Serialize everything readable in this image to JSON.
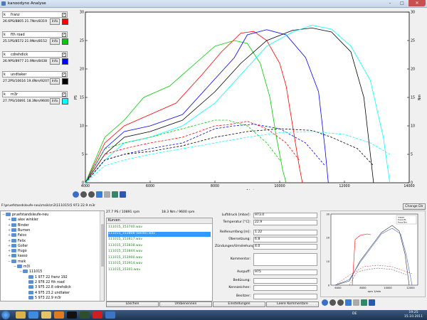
{
  "window": {
    "title": "kanoodyno Analyse"
  },
  "window_controls": {
    "minimize": "–",
    "maximize": "□",
    "close": "✕"
  },
  "cars": [
    {
      "name": "franz",
      "stats": "26.6PS/8805   21.7Nm/8319",
      "info": "Info",
      "color": "#ff0000",
      "checked": "✓"
    },
    {
      "name": "fth road",
      "stats": "25.1PS/8572   21.9Nm/8152",
      "info": "Info",
      "color": "#00cc00",
      "checked": "✓"
    },
    {
      "name": "cdrehdick",
      "stats": "26.9PS/8977   21.9Nm/8438",
      "info": "Info",
      "color": "#0000ff",
      "checked": "✓"
    },
    {
      "name": "undtaker",
      "stats": "27.2PS/10616  19.4Nm/9207",
      "info": "Info",
      "color": "#000000",
      "checked": "✓"
    },
    {
      "name": "m3r",
      "stats": "27.7PS/10891  18.3Nm/9600",
      "info": "Info",
      "color": "#00ffff",
      "checked": "✓"
    }
  ],
  "chart_data": {
    "type": "line",
    "title": "",
    "xlabel": "rpm 1/min",
    "ylabel_left": "PS",
    "ylabel_right": "Nm",
    "xlim": [
      4000,
      14000
    ],
    "ylim_left": [
      0,
      30
    ],
    "ylim_right": [
      0,
      30
    ],
    "x_ticks": [
      4000,
      6000,
      8000,
      10000,
      12000,
      14000
    ],
    "y_ticks_left": [
      0,
      5,
      10,
      15,
      20,
      25,
      30
    ],
    "y_ticks_right": [
      0,
      5,
      10,
      15,
      20,
      25,
      30
    ],
    "grid": false,
    "series": [
      {
        "color": "#ff0000",
        "kind": "power",
        "x": [
          4000,
          4600,
          5200,
          6000,
          6800,
          7600,
          8200,
          8800,
          9200,
          9600,
          10000,
          10200,
          10400,
          10600,
          10700
        ],
        "y": [
          0,
          7,
          10,
          12,
          14,
          19,
          23,
          26.3,
          26.6,
          25,
          21,
          17,
          10,
          3,
          0
        ]
      },
      {
        "color": "#00cc00",
        "kind": "power",
        "x": [
          4000,
          4600,
          5200,
          5800,
          6600,
          7400,
          8000,
          8600,
          9000,
          9400,
          9700,
          9900,
          10100,
          10200
        ],
        "y": [
          0,
          8,
          11,
          15,
          17,
          21,
          24,
          25,
          24.5,
          21,
          15,
          8,
          2,
          0
        ]
      },
      {
        "color": "#0000ff",
        "kind": "power",
        "x": [
          4000,
          4600,
          5200,
          6000,
          7000,
          7800,
          8600,
          9000,
          9600,
          10200,
          10800,
          11200,
          11400,
          11500
        ],
        "y": [
          0,
          6,
          9,
          10,
          12,
          17,
          22,
          26,
          26.9,
          26,
          22,
          16,
          6,
          0
        ]
      },
      {
        "color": "#000000",
        "kind": "power",
        "x": [
          4000,
          4600,
          5200,
          6000,
          7000,
          8000,
          8800,
          9600,
          10400,
          11000,
          11600,
          12200,
          12600,
          12800,
          12900
        ],
        "y": [
          0,
          5,
          8,
          9,
          11,
          16,
          21,
          25,
          26.8,
          27.2,
          26.5,
          23,
          15,
          5,
          0
        ]
      },
      {
        "color": "#00ffff",
        "kind": "power",
        "x": [
          4000,
          4600,
          5200,
          6000,
          7000,
          8000,
          8800,
          9600,
          10400,
          11000,
          11600,
          12200,
          12800,
          13200,
          13400
        ],
        "y": [
          0,
          4,
          7,
          8,
          10,
          14,
          19,
          24,
          26.5,
          27.7,
          27,
          24,
          18,
          8,
          0
        ]
      },
      {
        "color": "#ff0000",
        "kind": "torque",
        "x": [
          4000,
          4600,
          5200,
          6000,
          7000,
          8000,
          8400,
          9000,
          9600,
          10200,
          10600
        ],
        "y": [
          0,
          5,
          6,
          7,
          8,
          10,
          10.2,
          10.8,
          9.5,
          7,
          4
        ]
      },
      {
        "color": "#00cc00",
        "kind": "torque",
        "x": [
          4000,
          4600,
          5200,
          6000,
          7000,
          8000,
          8400,
          9000,
          9600,
          10000
        ],
        "y": [
          0,
          6,
          7,
          8,
          9.5,
          11,
          11,
          10,
          7,
          4
        ]
      },
      {
        "color": "#0000ff",
        "kind": "torque",
        "x": [
          4000,
          4600,
          5200,
          6000,
          7000,
          8000,
          8600,
          9200,
          10000,
          10800,
          11400
        ],
        "y": [
          0,
          4,
          5,
          6,
          7,
          9.5,
          10,
          10.3,
          9.5,
          7,
          3
        ]
      },
      {
        "color": "#000000",
        "kind": "torque",
        "x": [
          4000,
          4600,
          5200,
          6000,
          7000,
          8000,
          9000,
          10000,
          11000,
          11600,
          12400,
          12900
        ],
        "y": [
          0,
          4,
          5,
          5.5,
          6.5,
          8,
          9,
          9.5,
          9.2,
          8,
          6,
          3
        ]
      },
      {
        "color": "#00ffff",
        "kind": "torque",
        "x": [
          4000,
          4600,
          5200,
          6000,
          7000,
          8000,
          9000,
          10000,
          11000,
          12000,
          12800,
          13400
        ],
        "y": [
          0,
          3,
          4,
          5,
          6,
          7,
          8,
          8.8,
          9,
          8.5,
          7,
          5
        ]
      }
    ]
  },
  "path": {
    "text": "F:\\pruefstandsleufe-neu\\msik\\m3\\111015\\5 973 22.9 m3r",
    "change_button": "Change Dir"
  },
  "tree": [
    {
      "label": "pruefstandsleufe-neu",
      "level": 0,
      "exp": "−"
    },
    {
      "label": "alex winkler",
      "level": 1,
      "exp": "+"
    },
    {
      "label": "Binder",
      "level": 1,
      "exp": "+"
    },
    {
      "label": "Burnen",
      "level": 1,
      "exp": "+"
    },
    {
      "label": "Falco",
      "level": 1,
      "exp": "+"
    },
    {
      "label": "Felix",
      "level": 1,
      "exp": "+"
    },
    {
      "label": "Goller",
      "level": 1,
      "exp": "+"
    },
    {
      "label": "Hugo",
      "level": 1,
      "exp": "+"
    },
    {
      "label": "kasso",
      "level": 1,
      "exp": "+"
    },
    {
      "label": "msik",
      "level": 1,
      "exp": "−"
    },
    {
      "label": "m3l",
      "level": 2,
      "exp": "−"
    },
    {
      "label": "111015",
      "level": 3,
      "exp": "−"
    },
    {
      "label": "1 977 22 franz 192",
      "level": 4,
      "exp": ""
    },
    {
      "label": "2 976 22 fth road",
      "level": 4,
      "exp": ""
    },
    {
      "label": "3 975 22.8 cdrehdick",
      "level": 4,
      "exp": ""
    },
    {
      "label": "4 975 23.2 undtaker",
      "level": 4,
      "exp": ""
    },
    {
      "label": "5 973 22.9 m3r",
      "level": 4,
      "exp": ""
    }
  ],
  "curves": {
    "summary_power": "27.7 PS / 10891 rpm",
    "summary_torque": "18.3 Nm / 9600 rpm",
    "header": "Kurven",
    "items": [
      "111015_153740.wav",
      "111015_153808 (beste).wav",
      "111015_153817.wav",
      "111015_153838.wav",
      "111015_153844.wav",
      "111015_153900.wav",
      "111015_153914.wav",
      "111015_15301.wav"
    ],
    "selected_index": 1
  },
  "form": {
    "luftdruck_label": "Luftdruck [mbar]:",
    "luftdruck": "973.0",
    "temperatur_label": "Temperatur [°C]:",
    "temperatur": "22.9",
    "reifenumfang_label": "Reifenumfang [m]:",
    "reifenumfang": "1.22",
    "uebersetzung_label": "Übersetzung:",
    "uebersetzung": "6.8",
    "zuendungen_label": "Zündungen/Umdrehung:",
    "zuendungen": "4.0",
    "kommentar_label": "Kommentar:",
    "kommentar": "",
    "auspuff_label": "Auspuff:",
    "auspuff": "975",
    "bedusung_label": "Bedüsung:",
    "bedusung": "",
    "kennzeichen_label": "Kennzeichen:",
    "kennzeichen": "",
    "besitzer_label": "Besitzer:",
    "besitzer": ""
  },
  "buttons": {
    "loeschen": "Löschen",
    "umbenennen": "Umbenennen",
    "einstellungen": "Einstellungen",
    "leere_kommentare": "Leere Kommentare"
  },
  "mini_chart": {
    "legend": [
      "messe",
      "franz PS",
      "franz Nm"
    ],
    "x_ticks": [
      "6000",
      "8000",
      "10000",
      "12000"
    ],
    "y_ticks": [
      "0",
      "10",
      "20",
      "30"
    ],
    "xlabel": "rpm 1/min"
  },
  "taskbar": {
    "lang": "DE",
    "time": "19:25",
    "date": "15.10.2011"
  }
}
